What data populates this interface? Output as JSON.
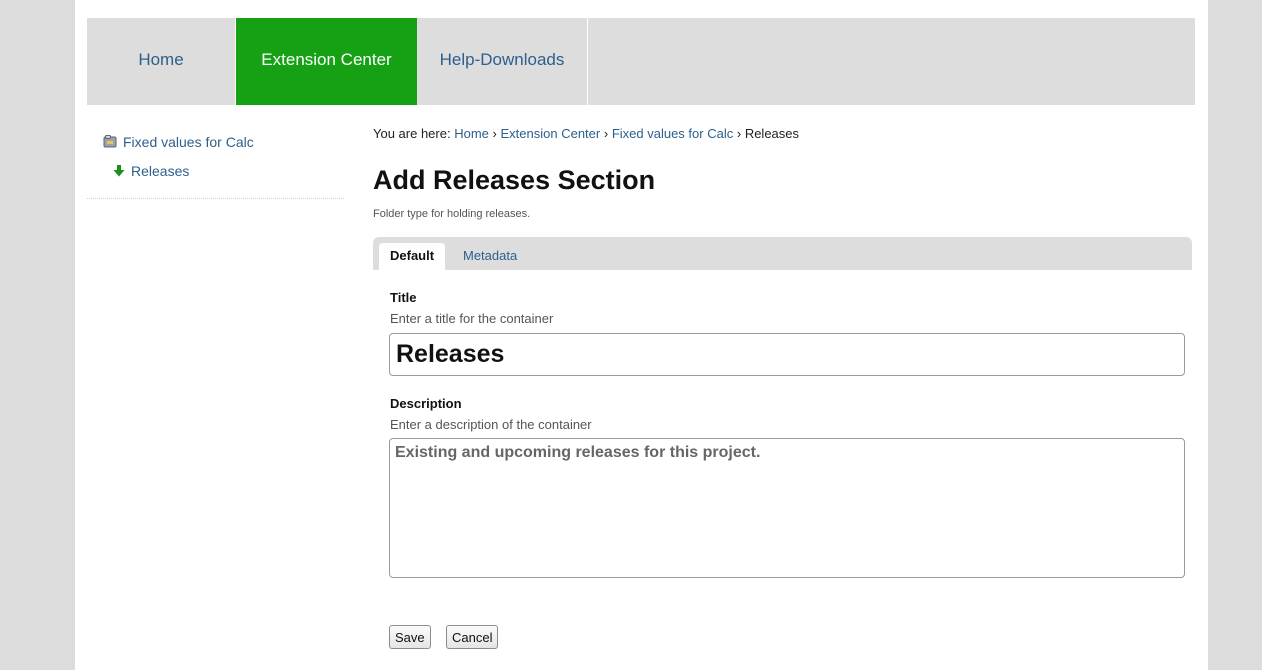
{
  "nav": {
    "home": "Home",
    "extension_center": "Extension Center",
    "help_downloads": "Help-Downloads"
  },
  "sidebar": {
    "items": [
      {
        "label": "Fixed values for Calc",
        "icon": "folder-icon"
      },
      {
        "label": "Releases",
        "icon": "down-arrow-icon"
      }
    ]
  },
  "breadcrumb": {
    "prefix": "You are here:",
    "items": [
      "Home",
      "Extension Center",
      "Fixed values for Calc",
      "Releases"
    ],
    "separator": "›"
  },
  "page": {
    "title": "Add Releases Section",
    "subtitle": "Folder type for holding releases."
  },
  "tabs": [
    {
      "label": "Default"
    },
    {
      "label": "Metadata"
    }
  ],
  "form": {
    "title_label": "Title",
    "title_help": "Enter a title for the container",
    "title_value": "Releases",
    "description_label": "Description",
    "description_help": "Enter a description of the container",
    "description_value": "Existing and upcoming releases for this project."
  },
  "buttons": {
    "save": "Save",
    "cancel": "Cancel"
  },
  "colors": {
    "accent_green": "#16a014",
    "link_blue": "#2c5f8c",
    "nav_gray": "#dddddd"
  }
}
